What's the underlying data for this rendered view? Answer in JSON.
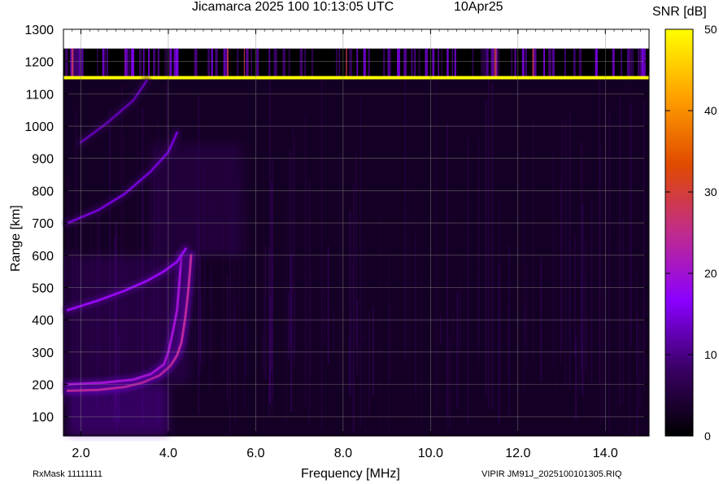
{
  "header": {
    "title": "Jicamarca 2025 100 10:13:05 UTC",
    "date": "10Apr25"
  },
  "colorbar": {
    "label": "SNR [dB]",
    "ticks": [
      "50",
      "40",
      "30",
      "20",
      "10",
      "0"
    ],
    "range": [
      0,
      50
    ],
    "colors": [
      "#000000",
      "#3a0066",
      "#8a00ff",
      "#c02c8c",
      "#e04a00",
      "#ffa000",
      "#ffff00"
    ]
  },
  "footer": {
    "rxmask": "RxMask 11111111",
    "file": "VIPIR  JM91J_2025100101305.RIQ"
  },
  "chart_data": {
    "type": "heatmap",
    "title": "Jicamarca 2025 100 10:13:05 UTC",
    "xlabel": "Frequency [MHz]",
    "ylabel": "Range [km]",
    "xlim": [
      1.6,
      15.0
    ],
    "ylim": [
      40,
      1300
    ],
    "x_ticks": [
      "2.0",
      "4.0",
      "6.0",
      "8.0",
      "10.0",
      "12.0",
      "14.0"
    ],
    "y_ticks": [
      "100",
      "200",
      "300",
      "400",
      "500",
      "600",
      "700",
      "800",
      "900",
      "1000",
      "1100",
      "1200",
      "1300"
    ],
    "background_snr_db": 3,
    "traces": [
      {
        "name_hidden": "o_mode",
        "snr_db": 24,
        "points": [
          [
            1.7,
            180
          ],
          [
            2.4,
            183
          ],
          [
            3.0,
            192
          ],
          [
            3.4,
            205
          ],
          [
            3.8,
            228
          ],
          [
            4.05,
            258
          ],
          [
            4.2,
            290
          ],
          [
            4.3,
            330
          ],
          [
            4.38,
            400
          ],
          [
            4.45,
            480
          ],
          [
            4.5,
            560
          ],
          [
            4.52,
            600
          ]
        ]
      },
      {
        "name_hidden": "o_mode_2",
        "snr_db": 20,
        "points": [
          [
            1.7,
            200
          ],
          [
            2.5,
            205
          ],
          [
            3.2,
            215
          ],
          [
            3.6,
            232
          ],
          [
            3.9,
            262
          ],
          [
            4.0,
            300
          ],
          [
            4.1,
            360
          ],
          [
            4.2,
            430
          ],
          [
            4.25,
            510
          ],
          [
            4.3,
            600
          ]
        ]
      },
      {
        "name_hidden": "multihop_2",
        "snr_db": 18,
        "points": [
          [
            1.7,
            430
          ],
          [
            2.4,
            460
          ],
          [
            3.0,
            490
          ],
          [
            3.5,
            520
          ],
          [
            3.9,
            550
          ],
          [
            4.2,
            580
          ],
          [
            4.4,
            620
          ]
        ]
      },
      {
        "name_hidden": "multihop_3",
        "snr_db": 14,
        "points": [
          [
            1.7,
            700
          ],
          [
            2.4,
            740
          ],
          [
            3.0,
            790
          ],
          [
            3.6,
            860
          ],
          [
            4.0,
            920
          ],
          [
            4.2,
            980
          ]
        ]
      },
      {
        "name_hidden": "multihop_4",
        "snr_db": 12,
        "points": [
          [
            2.0,
            950
          ],
          [
            2.6,
            1010
          ],
          [
            3.2,
            1080
          ],
          [
            3.5,
            1140
          ]
        ]
      }
    ],
    "diffuse_regions": [
      {
        "x": [
          1.7,
          4.0
        ],
        "y": [
          40,
          200
        ],
        "snr_db": 14
      },
      {
        "x": [
          1.7,
          4.5
        ],
        "y": [
          200,
          600
        ],
        "snr_db": 9
      },
      {
        "x": [
          3.6,
          5.7
        ],
        "y": [
          600,
          950
        ],
        "snr_db": 8
      }
    ],
    "interference_band": {
      "y": [
        1150,
        1240
      ],
      "x": [
        1.6,
        15.0
      ],
      "snr_db": 12
    },
    "interference_line": {
      "y": 1150,
      "snr_db": 50
    }
  }
}
